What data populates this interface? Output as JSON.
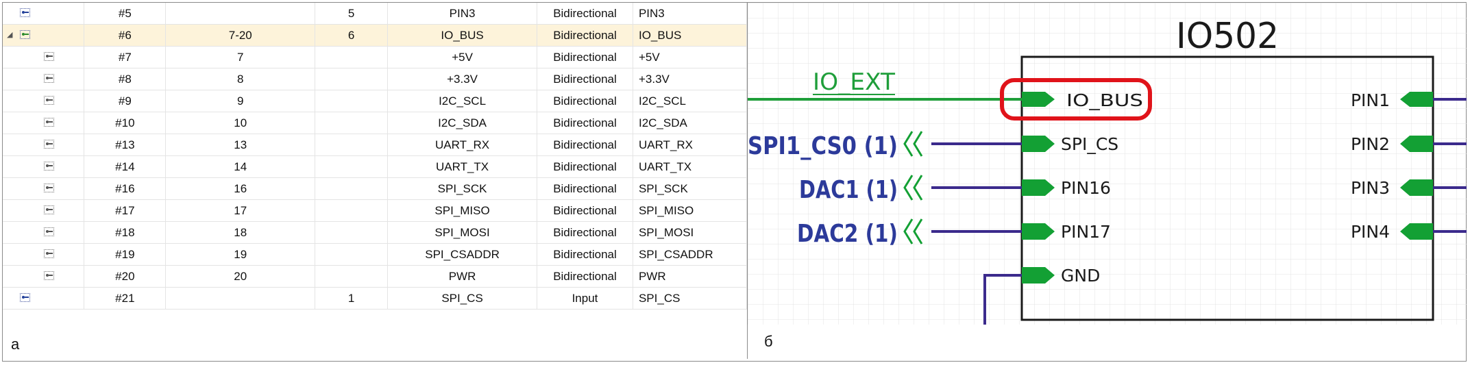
{
  "panel_a": {
    "label": "а",
    "rows": [
      {
        "level": "top",
        "icon": "pin-icon",
        "designator": "#5",
        "range": "",
        "num": "5",
        "name": "PIN3",
        "type": "Bidirectional",
        "net": "PIN3"
      },
      {
        "level": "top",
        "icon": "pin-group-icon",
        "designator": "#6",
        "range": "7-20",
        "num": "6",
        "name": "IO_BUS",
        "type": "Bidirectional",
        "net": "IO_BUS",
        "selected": true,
        "expanded": true
      },
      {
        "level": "sub",
        "icon": "pin-icon",
        "designator": "#7",
        "range": "7",
        "num": "",
        "name": "+5V",
        "type": "Bidirectional",
        "net": "+5V"
      },
      {
        "level": "sub",
        "icon": "pin-icon",
        "designator": "#8",
        "range": "8",
        "num": "",
        "name": "+3.3V",
        "type": "Bidirectional",
        "net": "+3.3V"
      },
      {
        "level": "sub",
        "icon": "pin-icon",
        "designator": "#9",
        "range": "9",
        "num": "",
        "name": "I2C_SCL",
        "type": "Bidirectional",
        "net": "I2C_SCL"
      },
      {
        "level": "sub",
        "icon": "pin-icon",
        "designator": "#10",
        "range": "10",
        "num": "",
        "name": "I2C_SDA",
        "type": "Bidirectional",
        "net": "I2C_SDA"
      },
      {
        "level": "sub",
        "icon": "pin-icon",
        "designator": "#13",
        "range": "13",
        "num": "",
        "name": "UART_RX",
        "type": "Bidirectional",
        "net": "UART_RX"
      },
      {
        "level": "sub",
        "icon": "pin-icon",
        "designator": "#14",
        "range": "14",
        "num": "",
        "name": "UART_TX",
        "type": "Bidirectional",
        "net": "UART_TX"
      },
      {
        "level": "sub",
        "icon": "pin-icon",
        "designator": "#16",
        "range": "16",
        "num": "",
        "name": "SPI_SCK",
        "type": "Bidirectional",
        "net": "SPI_SCK"
      },
      {
        "level": "sub",
        "icon": "pin-icon",
        "designator": "#17",
        "range": "17",
        "num": "",
        "name": "SPI_MISO",
        "type": "Bidirectional",
        "net": "SPI_MISO"
      },
      {
        "level": "sub",
        "icon": "pin-icon",
        "designator": "#18",
        "range": "18",
        "num": "",
        "name": "SPI_MOSI",
        "type": "Bidirectional",
        "net": "SPI_MOSI"
      },
      {
        "level": "sub",
        "icon": "pin-icon",
        "designator": "#19",
        "range": "19",
        "num": "",
        "name": "SPI_CSADDR",
        "type": "Bidirectional",
        "net": "SPI_CSADDR"
      },
      {
        "level": "sub",
        "icon": "pin-icon",
        "designator": "#20",
        "range": "20",
        "num": "",
        "name": "PWR",
        "type": "Bidirectional",
        "net": "PWR"
      },
      {
        "level": "top",
        "icon": "pin-icon",
        "designator": "#21",
        "range": "",
        "num": "1",
        "name": "SPI_CS",
        "type": "Input",
        "net": "SPI_CS"
      }
    ]
  },
  "panel_b": {
    "label": "б",
    "component_title": "IO502",
    "net_label": "IO_EXT",
    "highlighted_pin": "IO_BUS",
    "left_pins": [
      "SPI_CS",
      "PIN16",
      "PIN17",
      "GND"
    ],
    "right_pins": [
      "PIN1",
      "PIN2",
      "PIN3",
      "PIN4"
    ],
    "ports": [
      "SPI1_CS0 (1)",
      "DAC1 (1)",
      "DAC2 (1)"
    ],
    "colors": {
      "wire_green": "#1f9e3a",
      "pin_green": "#13a034",
      "wire_blue": "#3b2a8c",
      "port_text": "#2c3a9a",
      "highlight_red": "#e0131a",
      "grid": "#e3e3e3"
    }
  }
}
